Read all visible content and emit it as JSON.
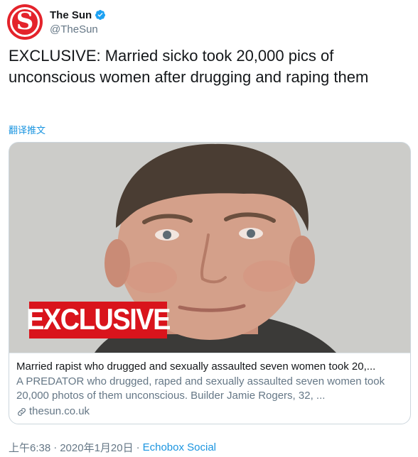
{
  "account": {
    "display_name": "The Sun",
    "handle": "@TheSun",
    "avatar_letter": "S",
    "avatar_color": "#e4232b"
  },
  "tweet": {
    "text": "EXCLUSIVE: Married sicko took 20,000 pics of unconscious women after drugging and raping them",
    "translate_label": "翻译推文"
  },
  "card": {
    "image_badge": "EXCLUSIVE",
    "title": "Married rapist who drugged and sexually assaulted seven women took 20,...",
    "description": "A PREDATOR who drugged, raped and sexually assaulted seven women took 20,000 photos of them unconscious. Builder Jamie Rogers, 32, ...",
    "domain": "thesun.co.uk",
    "link_icon": "link-icon"
  },
  "meta": {
    "time": "上午6:38",
    "separator": "·",
    "date": "2020年1月20日",
    "source": "Echobox Social"
  },
  "colors": {
    "accent": "#1b95e0",
    "secondary_text": "#657786",
    "badge_red": "#d9141c"
  }
}
